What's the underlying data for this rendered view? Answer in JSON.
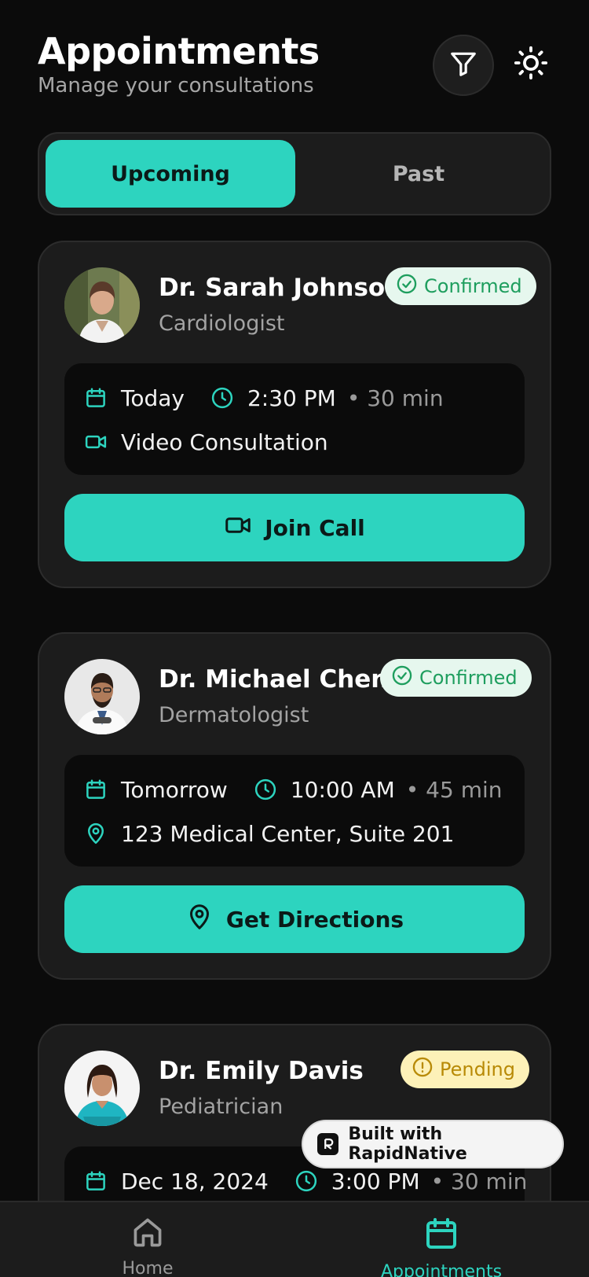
{
  "header": {
    "title": "Appointments",
    "subtitle": "Manage your consultations",
    "filter_icon": "filter-icon",
    "theme_icon": "sun-icon"
  },
  "segments": {
    "upcoming": "Upcoming",
    "past": "Past",
    "active": "Upcoming"
  },
  "colors": {
    "accent": "#2dd4bf",
    "background": "#0b0b0b",
    "card": "#1c1c1c",
    "confirmed_bg": "#e6f7ee",
    "confirmed_fg": "#1e9e5e",
    "pending_bg": "#fdf1b8",
    "pending_fg": "#b88a06"
  },
  "appointments": [
    {
      "doctor": "Dr. Sarah Johnson",
      "specialty": "Cardiologist",
      "status": "Confirmed",
      "date": "Today",
      "time": "2:30 PM",
      "duration": "• 30 min",
      "detail": "Video Consultation",
      "detail_icon": "video-icon",
      "action": "Join Call",
      "action_icon": "video-icon"
    },
    {
      "doctor": "Dr. Michael Chen",
      "specialty": "Dermatologist",
      "status": "Confirmed",
      "date": "Tomorrow",
      "time": "10:00 AM",
      "duration": "• 45 min",
      "detail": "123 Medical Center, Suite 201",
      "detail_icon": "map-pin-icon",
      "action": "Get Directions",
      "action_icon": "map-pin-icon"
    },
    {
      "doctor": "Dr. Emily Davis",
      "specialty": "Pediatrician",
      "status": "Pending",
      "date": "Dec 18, 2024",
      "time": "3:00 PM",
      "duration": "• 30 min"
    }
  ],
  "watermark": "Built with RapidNative",
  "tabs": [
    {
      "label": "Home",
      "icon": "home-icon",
      "active": false
    },
    {
      "label": "Appointments",
      "icon": "calendar-icon",
      "active": true
    }
  ]
}
